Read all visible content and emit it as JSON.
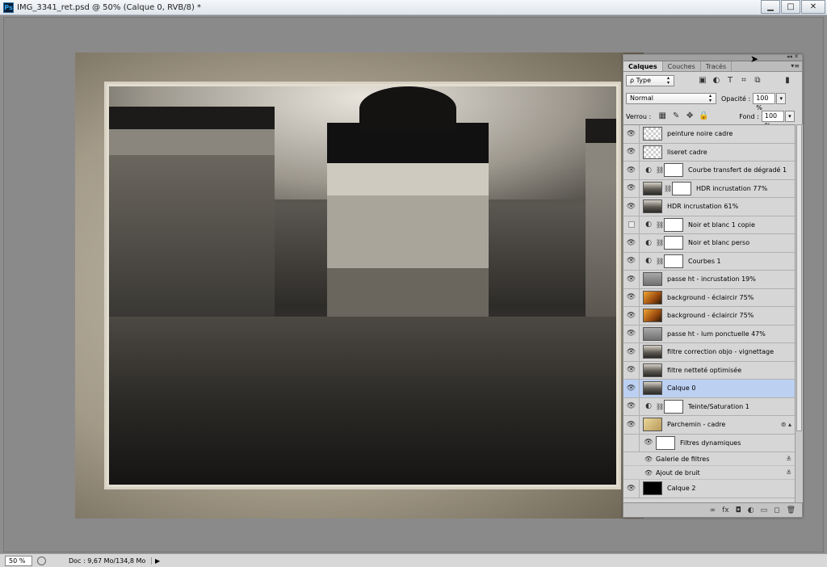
{
  "window": {
    "app_icon": "Ps",
    "title": "IMG_3341_ret.psd @ 50% (Calque 0, RVB/8) *",
    "minimize": "▁",
    "maximize": "□",
    "close": "✕"
  },
  "panel": {
    "collapse": "◂◂ ✕",
    "tabs": [
      "Calques",
      "Couches",
      "Tracés"
    ],
    "menu": "▾≡",
    "filter_type": "ρ Type",
    "blend_mode": "Normal",
    "opacity_label": "Opacité :",
    "opacity_value": "100 %",
    "lock_label": "Verrou :",
    "fill_label": "Fond :",
    "fill_value": "100 %",
    "layers": [
      {
        "name": "peinture noire cadre",
        "thumb": "check"
      },
      {
        "name": "liseret cadre",
        "thumb": "check"
      },
      {
        "name": "Courbe transfert de dégradé 1",
        "adjust": true,
        "mask": "white"
      },
      {
        "name": "HDR incrustation 77%",
        "thumb": "photo",
        "mask": "grad"
      },
      {
        "name": "HDR incrustation 61%",
        "thumb": "photo"
      },
      {
        "name": "Noir et blanc 1 copie",
        "adjust": true,
        "mask": "white",
        "hidden": true
      },
      {
        "name": "Noir et blanc perso",
        "adjust": true,
        "mask": "white"
      },
      {
        "name": "Courbes 1",
        "adjust": true,
        "mask": "white"
      },
      {
        "name": "passe ht - incrustation 19%",
        "thumb": "grey"
      },
      {
        "name": "background - éclaircir 75%",
        "thumb": "orange"
      },
      {
        "name": "background - éclaircir 75%",
        "thumb": "orange"
      },
      {
        "name": "passe ht - lum ponctuelle 47%",
        "thumb": "grey"
      },
      {
        "name": "filtre correction objo - vignettage",
        "thumb": "photo"
      },
      {
        "name": "filtre netteté optimisée",
        "thumb": "photo"
      },
      {
        "name": "Calque 0",
        "thumb": "photo",
        "selected": true
      },
      {
        "name": "Teinte/Saturation 1",
        "adjust": true,
        "mask": "white"
      },
      {
        "name": "Parchemin - cadre",
        "thumb": "parch"
      }
    ],
    "smart_filters": {
      "label": "Filtres dynamiques",
      "items": [
        "Galerie de filtres",
        "Ajout de bruit"
      ]
    },
    "last_layer": {
      "name": "Calque 2",
      "thumb": "black"
    },
    "bottom_icons": [
      "∞",
      "fx",
      "◘",
      "◐",
      "▭",
      "◻",
      "🗑"
    ]
  },
  "status": {
    "zoom": "50 %",
    "doc": "Doc : 9,67 Mo/134,8 Mo",
    "arrow": "▶"
  },
  "colors": {
    "selection": "#bcd0f2",
    "panel": "#d6d6d6",
    "workspace": "#8a8a8a"
  }
}
